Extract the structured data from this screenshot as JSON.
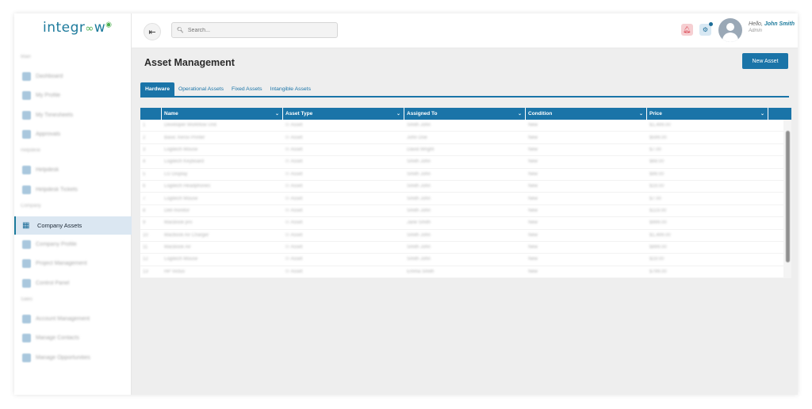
{
  "brand": {
    "logo_text": "integr",
    "logo_tail": "w",
    "logo_mark": "∞"
  },
  "sidebar": {
    "sections": [
      {
        "title": "Main",
        "items": [
          {
            "label": "Dashboard"
          },
          {
            "label": "My Profile"
          },
          {
            "label": "My Timesheets"
          },
          {
            "label": "Approvals"
          }
        ]
      },
      {
        "title": "Helpdesk",
        "items": [
          {
            "label": "Helpdesk"
          },
          {
            "label": "Helpdesk Tickets"
          }
        ]
      },
      {
        "title": "Company",
        "items": [
          {
            "label": "Company Assets",
            "active": true
          },
          {
            "label": "Company Profile"
          },
          {
            "label": "Project Management"
          },
          {
            "label": "Control Panel"
          }
        ]
      },
      {
        "title": "Sales",
        "items": [
          {
            "label": "Account Management"
          },
          {
            "label": "Manage Contacts"
          },
          {
            "label": "Manage Opportunities"
          }
        ]
      }
    ]
  },
  "header": {
    "search_placeholder": "Search...",
    "user": {
      "greeting": "Hello,",
      "name": "John Smith",
      "role": "Admin"
    }
  },
  "main": {
    "title": "Asset Management",
    "new_button": "New Asset",
    "tabs": [
      {
        "label": "Hardware",
        "active": true
      },
      {
        "label": "Operational Assets"
      },
      {
        "label": "Fixed Assets"
      },
      {
        "label": "Intangible Assets"
      }
    ],
    "grid": {
      "columns": [
        "",
        "Name",
        "Asset Type",
        "Assigned To",
        "Condition",
        "Price"
      ],
      "rows": [
        [
          "1",
          "Developer Workflow Unit",
          "IT Asset",
          "Smith John",
          "New",
          "$1,499.00"
        ],
        [
          "2",
          "Basic Xerox Printer",
          "IT Asset",
          "John Doe",
          "New",
          "$599.00"
        ],
        [
          "3",
          "Logitech Mouse",
          "IT Asset",
          "David Wright",
          "New",
          "$7.00"
        ],
        [
          "4",
          "Logitech Keyboard",
          "IT Asset",
          "Smith John",
          "New",
          "$69.00"
        ],
        [
          "5",
          "LG Display",
          "IT Asset",
          "Smith John",
          "New",
          "$99.00"
        ],
        [
          "6",
          "Logitech Headphones",
          "IT Asset",
          "Smith John",
          "New",
          "$19.00"
        ],
        [
          "7",
          "Logitech Mouse",
          "IT Asset",
          "Smith John",
          "New",
          "$7.00"
        ],
        [
          "8",
          "Dell monitor",
          "IT Asset",
          "Smith John",
          "New",
          "$119.00"
        ],
        [
          "9",
          "MacBook pro",
          "IT Asset",
          "Jane Smith",
          "New",
          "$999.00"
        ],
        [
          "10",
          "Macbook Air Charger",
          "IT Asset",
          "Smith John",
          "New",
          "$1,499.00"
        ],
        [
          "11",
          "MacBook Air",
          "IT Asset",
          "Smith John",
          "New",
          "$899.00"
        ],
        [
          "12",
          "Logitech Mouse",
          "IT Asset",
          "Smith John",
          "New",
          "$19.00"
        ],
        [
          "13",
          "HP Victus",
          "IT Asset",
          "Emma Smith",
          "New",
          "$799.00"
        ]
      ]
    }
  },
  "colors": {
    "primary": "#1a74a8",
    "brand": "#1c7a9c",
    "accent_green": "#4caf50",
    "alert": "#d9434f"
  }
}
